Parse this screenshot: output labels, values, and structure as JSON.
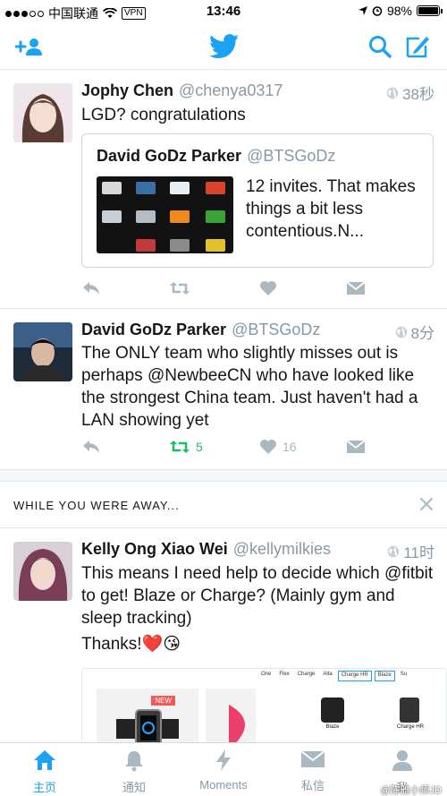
{
  "status_bar": {
    "carrier": "中国联通",
    "vpn": "VPN",
    "time": "13:46",
    "battery": "98%",
    "battery_level": 0.98
  },
  "nav": {
    "add_user_icon": "add-user-icon",
    "logo": "twitter-bird-logo",
    "search_icon": "search-icon",
    "compose_icon": "compose-icon"
  },
  "tweets": [
    {
      "name": "Jophy Chen",
      "handle": "@chenya0317",
      "time": "38秒",
      "text": "LGD? congratulations",
      "quote": {
        "name": "David GoDz Parker",
        "handle": "@BTSGoDz",
        "text": "12 invites. That makes things a bit less contentious.N..."
      },
      "retweets": "",
      "likes": ""
    },
    {
      "name": "David GoDz Parker",
      "handle": "@BTSGoDz",
      "time": "8分",
      "text": "The ONLY team who slightly misses out is perhaps @NewbeeCN who have looked like the strongest China team. Just haven't had a LAN showing yet",
      "retweets": "5",
      "likes": "16"
    },
    {
      "name": "Kelly Ong Xiao Wei",
      "handle": "@kellymilkies",
      "time": "11时",
      "text": "This means I need help to decide which @fitbit to get! Blaze or Charge? (Mainly gym and sleep tracking)",
      "text2": "Thanks!❤️😘"
    }
  ],
  "away": {
    "title": "WHILE YOU WERE AWAY..."
  },
  "media_preview": {
    "badge": "NEW",
    "tabs": [
      "One",
      "Flex",
      "Charge",
      "Alta",
      "Charge HR",
      "Blaze",
      "Su"
    ],
    "products": [
      "Blaze",
      "Charge HR"
    ]
  },
  "tab_bar": {
    "tabs": [
      {
        "label": "主页",
        "icon": "home-icon",
        "active": true
      },
      {
        "label": "通知",
        "icon": "bell-icon",
        "active": false
      },
      {
        "label": "Moments",
        "icon": "lightning-icon",
        "active": false
      },
      {
        "label": "私信",
        "icon": "envelope-icon",
        "active": false
      },
      {
        "label": "我",
        "icon": "person-icon",
        "active": false
      }
    ],
    "watermark": "@陈雅小师JD"
  },
  "colors": {
    "brand": "#1da1f2",
    "retweet_green": "#17bf63",
    "muted": "#8899a6"
  }
}
